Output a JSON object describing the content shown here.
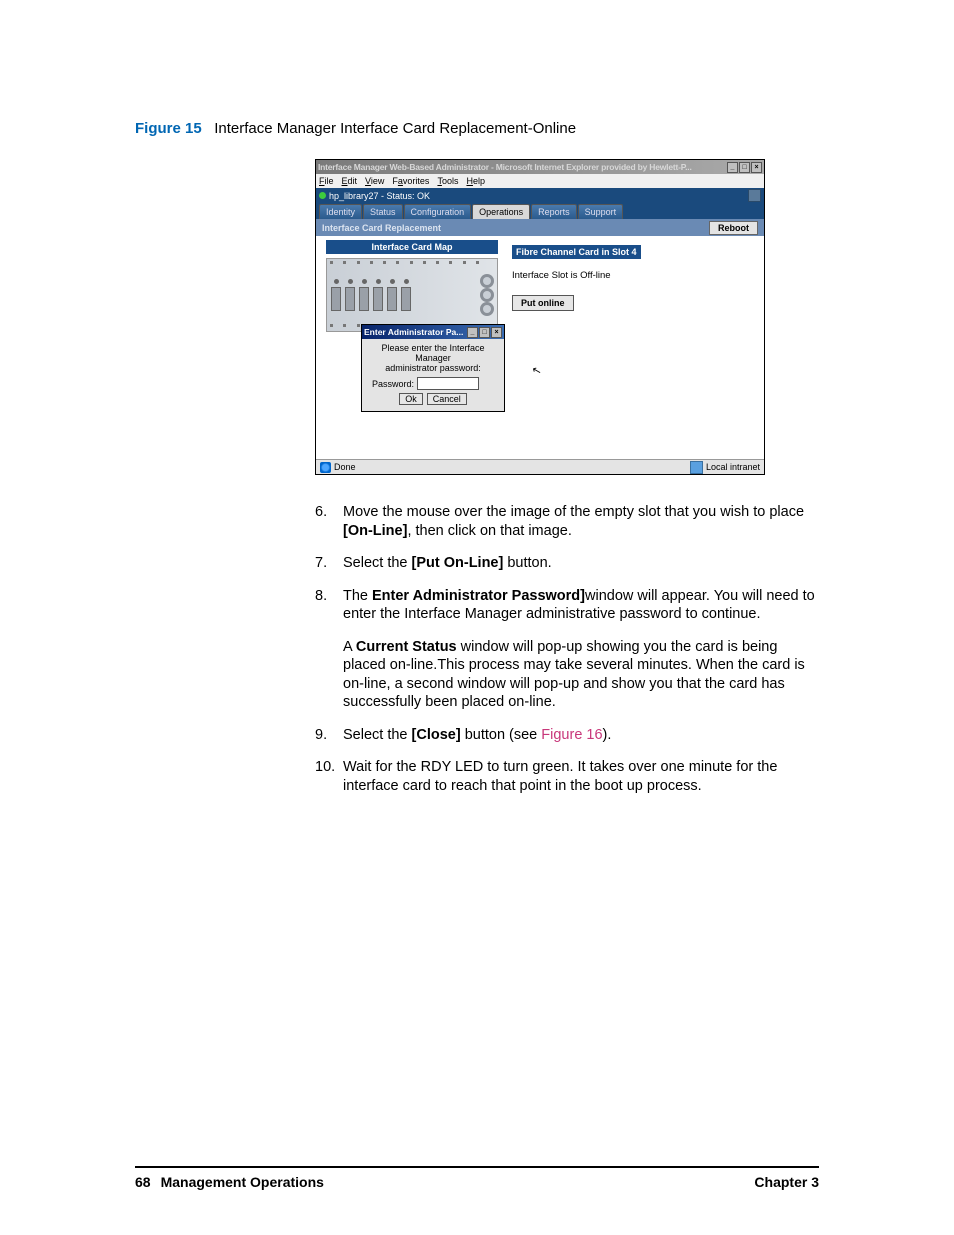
{
  "figure": {
    "label": "Figure 15",
    "caption": "Interface Manager Interface Card Replacement-Online"
  },
  "screenshot": {
    "window_title": "Interface Manager Web-Based Administrator - Microsoft Internet Explorer provided by Hewlett-P...",
    "menu": {
      "file": "File",
      "edit": "Edit",
      "view": "View",
      "favorites": "Favorites",
      "tools": "Tools",
      "help": "Help"
    },
    "status_line": "hp_library27 - Status: OK",
    "tabs": {
      "identity": "Identity",
      "status": "Status",
      "configuration": "Configuration",
      "operations": "Operations",
      "reports": "Reports",
      "support": "Support"
    },
    "subbar_title": "Interface Card Replacement",
    "reboot": "Reboot",
    "map_header": "Interface Card Map",
    "info_header": "Fibre Channel Card in Slot 4",
    "info_text": "Interface Slot is Off-line",
    "put_online": "Put online",
    "dialog": {
      "title": "Enter Administrator Pa...",
      "msg1": "Please enter the Interface Manager",
      "msg2": "administrator password:",
      "pw_label": "Password:",
      "ok": "Ok",
      "cancel": "Cancel"
    },
    "done": "Done",
    "zone": "Local intranet"
  },
  "steps": {
    "s6": {
      "num": "6.",
      "a": "Move the mouse over the image of the empty slot that you wish to place ",
      "bold": "[On-Line]",
      "b": ", then click on that image."
    },
    "s7": {
      "num": "7.",
      "a": "Select the ",
      "bold": "[Put On-Line]",
      "b": " button."
    },
    "s8": {
      "num": "8.",
      "a": "The ",
      "bold": "Enter Administrator Password]",
      "b": "window will appear. You will need to enter the Interface Manager administrative password to continue.",
      "p2a": "A ",
      "p2bold": "Current Status",
      "p2b": " window will pop-up showing you the card is being placed on-line.This process may take several minutes. When the card is on-line, a second window will pop-up and show you that the card has successfully been placed on-line."
    },
    "s9": {
      "num": "9.",
      "a": "Select the  ",
      "bold": "[Close]",
      "b": " button (see ",
      "link": "Figure 16",
      "c": ")."
    },
    "s10": {
      "num": "10.",
      "a": "Wait for the RDY LED to turn green. It takes over one minute for the interface card to reach that point in the boot up process."
    }
  },
  "footer": {
    "page": "68",
    "section": "Management Operations",
    "chapter": "Chapter 3"
  }
}
